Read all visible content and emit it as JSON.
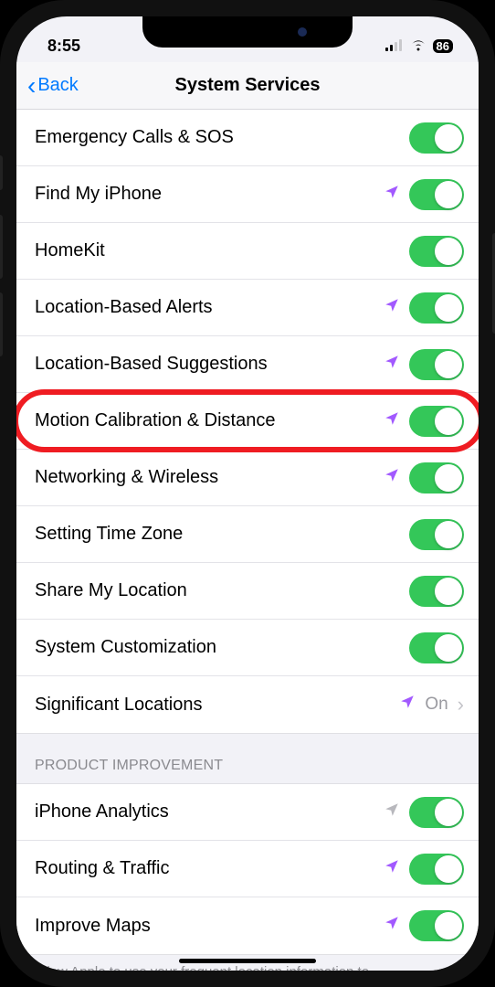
{
  "status": {
    "time": "8:55",
    "battery": "86"
  },
  "nav": {
    "back": "Back",
    "title": "System Services"
  },
  "services": [
    {
      "label": "Emergency Calls & SOS",
      "arrow": "",
      "toggle": true
    },
    {
      "label": "Find My iPhone",
      "arrow": "purple",
      "toggle": true
    },
    {
      "label": "HomeKit",
      "arrow": "",
      "toggle": true
    },
    {
      "label": "Location-Based Alerts",
      "arrow": "purple",
      "toggle": true
    },
    {
      "label": "Location-Based Suggestions",
      "arrow": "purple",
      "toggle": true
    },
    {
      "label": "Motion Calibration & Distance",
      "arrow": "purple",
      "toggle": true,
      "highlight": true
    },
    {
      "label": "Networking & Wireless",
      "arrow": "purple",
      "toggle": true
    },
    {
      "label": "Setting Time Zone",
      "arrow": "",
      "toggle": true
    },
    {
      "label": "Share My Location",
      "arrow": "",
      "toggle": true
    },
    {
      "label": "System Customization",
      "arrow": "",
      "toggle": true
    },
    {
      "label": "Significant Locations",
      "arrow": "purple",
      "detail": "On",
      "disclosure": true
    }
  ],
  "section2_header": "PRODUCT IMPROVEMENT",
  "improvement": [
    {
      "label": "iPhone Analytics",
      "arrow": "gray",
      "toggle": true
    },
    {
      "label": "Routing & Traffic",
      "arrow": "purple",
      "toggle": true
    },
    {
      "label": "Improve Maps",
      "arrow": "purple",
      "toggle": true
    }
  ],
  "footer_note": "Allow Apple to use your frequent location information to"
}
